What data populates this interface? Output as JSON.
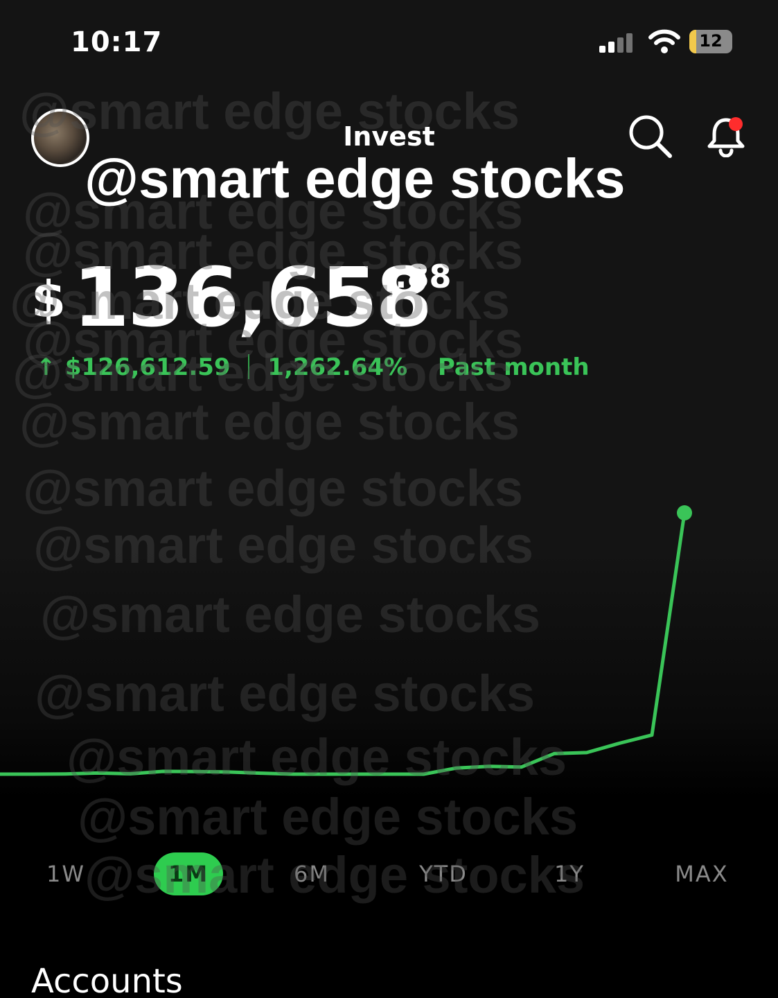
{
  "status_bar": {
    "time": "10:17",
    "battery_level": "12",
    "battery_color": "#f2c94c",
    "signal_icon": "signal-icon",
    "wifi_icon": "wifi-icon"
  },
  "header": {
    "title": "Invest",
    "avatar": "avatar",
    "search_icon": "search-icon",
    "notifications_icon": "bell-icon",
    "notification_dot_color": "#ff2d2d"
  },
  "watermark": {
    "text": "@smart edge stocks"
  },
  "portfolio": {
    "currency_symbol": "$",
    "value_main": "136,658",
    "value_cents": ".88",
    "change_arrow": "↑",
    "change_amount": "$126,612.59",
    "change_percent": "1,262.64%",
    "change_period": "Past month",
    "positive_color": "#3ac458"
  },
  "chart_data": {
    "type": "line",
    "title": "",
    "xlabel": "",
    "ylabel": "",
    "y_axis_shown": false,
    "grid": false,
    "series": [
      {
        "values": [
          10046.29,
          10046.29,
          10150,
          10600,
          10200,
          11400,
          11300,
          11100,
          10500,
          10046.29,
          10046.29,
          10046.29,
          10046.29,
          10046.29,
          13000,
          13800,
          13500,
          20000,
          20500,
          25000,
          29000,
          136658.88
        ]
      }
    ],
    "ylim": [
      0,
      160000
    ],
    "line_color": "#3ac458",
    "end_marker": true
  },
  "range_selector": {
    "options": [
      "1W",
      "1M",
      "6M",
      "YTD",
      "1Y",
      "MAX"
    ],
    "selected": "1M",
    "active_color": "#2ecc4f"
  },
  "sections": {
    "accounts_title": "Accounts"
  }
}
